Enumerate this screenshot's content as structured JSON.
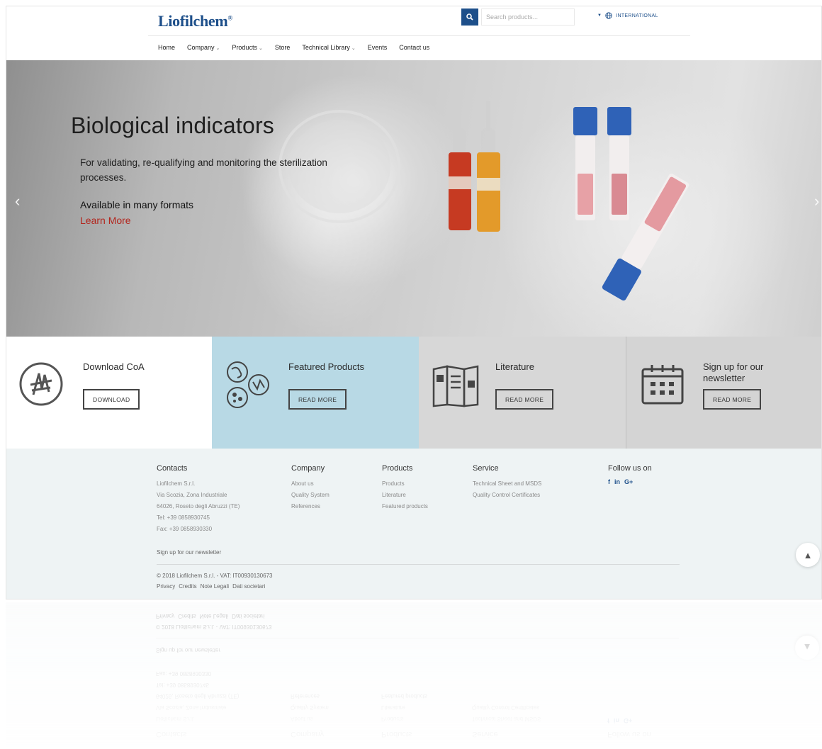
{
  "header": {
    "logo": "Liofilchem",
    "logo_mark": "®",
    "search_placeholder": "Search products...",
    "language": "INTERNATIONAL",
    "nav": [
      "Home",
      "Company",
      "Products",
      "Store",
      "Technical Library",
      "Events",
      "Contact us"
    ]
  },
  "hero": {
    "title": "Biological indicators",
    "subtitle": "For validating, re-qualifying and monitoring the sterilization processes.",
    "formats": "Available in many formats",
    "link": "Learn More"
  },
  "promos": [
    {
      "title": "Download CoA",
      "button": "DOWNLOAD",
      "icon": "coa-seal-icon"
    },
    {
      "title": "Featured Products",
      "button": "READ MORE",
      "icon": "petri-dishes-icon"
    },
    {
      "title": "Literature",
      "button": "READ MORE",
      "icon": "brochure-icon"
    },
    {
      "title": "Sign up for our newsletter",
      "button": "READ MORE",
      "icon": "calendar-icon"
    }
  ],
  "footer": {
    "contacts": {
      "title": "Contacts",
      "lines": [
        "Liofilchem S.r.l.",
        "Via Scozia, Zona Industriale",
        "64026, Roseto degli Abruzzi (TE)",
        "Tel: +39 0858930745",
        "Fax: +39 0858930330"
      ]
    },
    "company": {
      "title": "Company",
      "links": [
        "About us",
        "Quality System",
        "References"
      ]
    },
    "products": {
      "title": "Products",
      "links": [
        "Products",
        "Literature",
        "Featured products"
      ]
    },
    "service": {
      "title": "Service",
      "links": [
        "Technical Sheet and MSDS",
        "Quality Control Certificates"
      ]
    },
    "follow": {
      "title": "Follow us on",
      "social": [
        "f",
        "in",
        "G+"
      ]
    },
    "newsletter": "Sign up for our newsletter",
    "copyright": "© 2018 Liofilchem S.r.l. - VAT: IT00930130673",
    "legal": [
      "Privacy",
      "Credits",
      "Note Legali",
      "Dati societari"
    ]
  },
  "colors": {
    "brand": "#1d4f8a",
    "link_red": "#b3261e",
    "featured_bg": "#b8d9e5",
    "footer_bg": "#eef3f4"
  }
}
